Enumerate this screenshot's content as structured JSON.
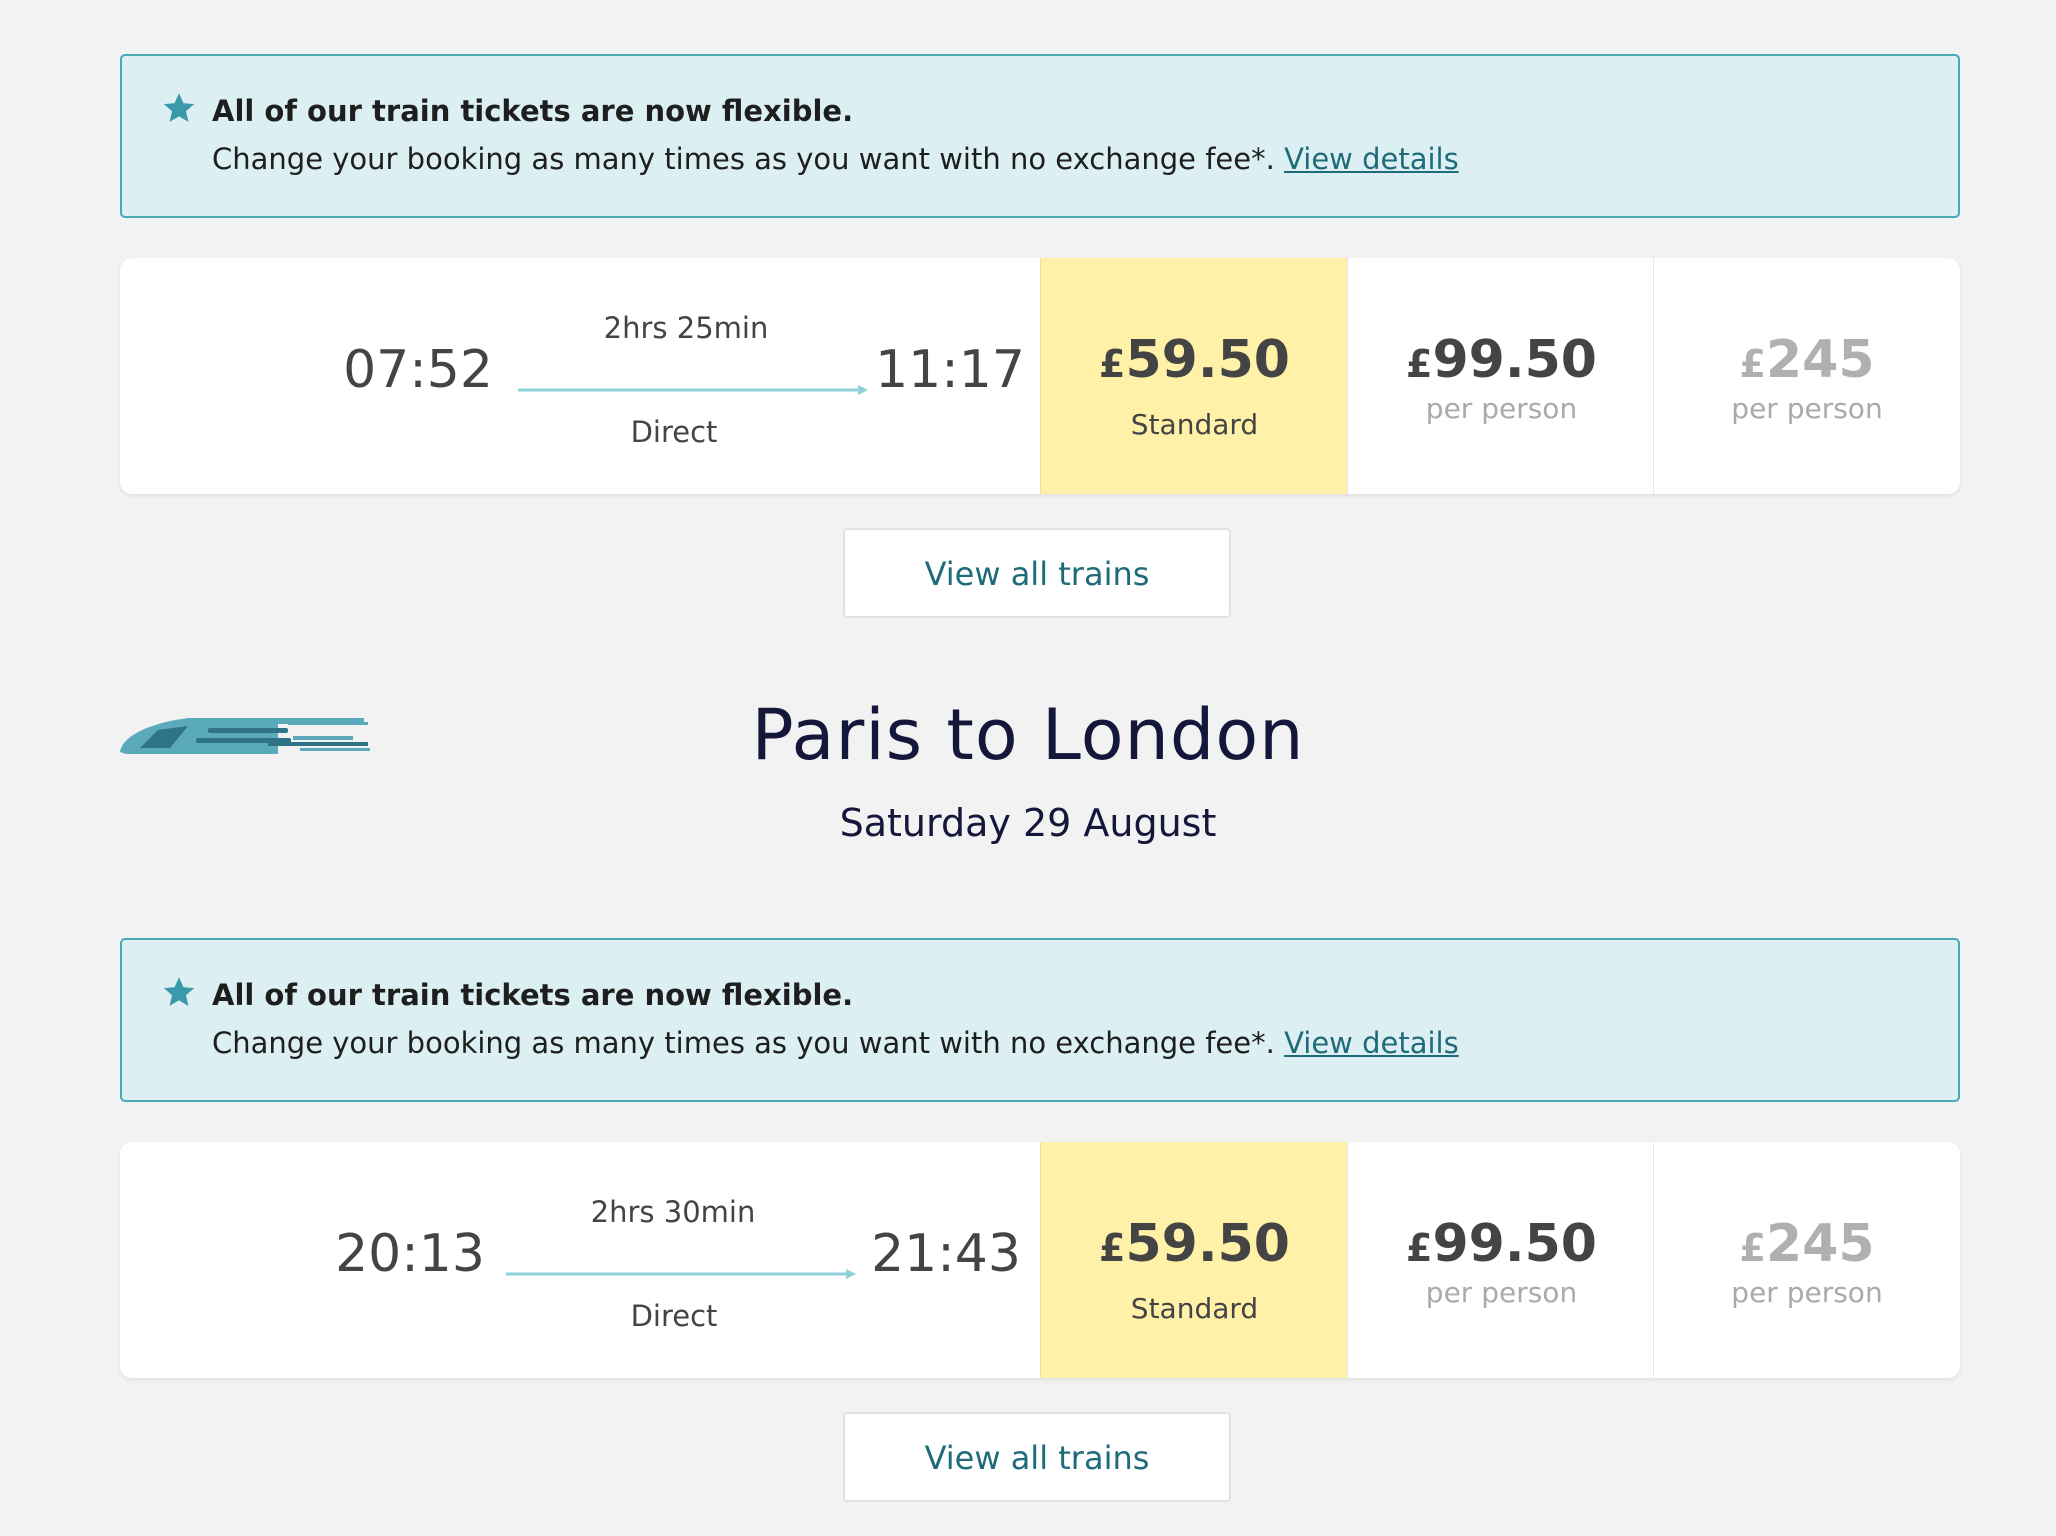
{
  "outbound": {
    "notice": {
      "title": "All of our train tickets are now flexible.",
      "body": "Change your booking as many times as you want with no exchange fee*.",
      "link": "View details"
    },
    "result": {
      "depart": "07:52",
      "arrive": "11:17",
      "duration": "2hrs 25min",
      "stops": "Direct",
      "fares": [
        {
          "currency": "£",
          "amount": "59.50",
          "label": "Standard"
        },
        {
          "currency": "£",
          "amount": "99.50",
          "label": "per person"
        },
        {
          "currency": "£",
          "amount": "245",
          "label": "per person"
        }
      ]
    },
    "view_all": "View all trains"
  },
  "return_header": {
    "title": "Paris to London",
    "date": "Saturday 29 August",
    "icon": "train-icon"
  },
  "inbound": {
    "notice": {
      "title": "All of our train tickets are now flexible.",
      "body": "Change your booking as many times as you want with no exchange fee*.",
      "link": "View details"
    },
    "result": {
      "depart": "20:13",
      "arrive": "21:43",
      "duration": "2hrs 30min",
      "stops": "Direct",
      "fares": [
        {
          "currency": "£",
          "amount": "59.50",
          "label": "Standard"
        },
        {
          "currency": "£",
          "amount": "99.50",
          "label": "per person"
        },
        {
          "currency": "£",
          "amount": "245",
          "label": "per person"
        }
      ]
    },
    "view_all": "View all trains"
  },
  "colors": {
    "notice_bg": "#dceff3",
    "notice_border": "#4aa7b4",
    "standard_fare_bg": "#fff2a8",
    "link": "#1f6b7a",
    "heading": "#14163a"
  }
}
